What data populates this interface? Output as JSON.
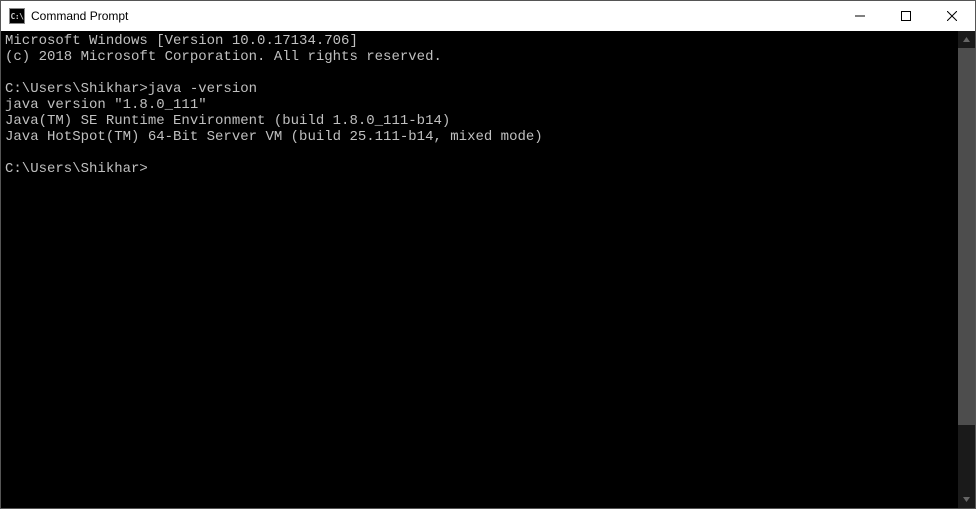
{
  "window": {
    "title": "Command Prompt",
    "icon_label": "C:\\"
  },
  "terminal": {
    "lines": [
      "Microsoft Windows [Version 10.0.17134.706]",
      "(c) 2018 Microsoft Corporation. All rights reserved.",
      "",
      "C:\\Users\\Shikhar>java -version",
      "java version \"1.8.0_111\"",
      "Java(TM) SE Runtime Environment (build 1.8.0_111-b14)",
      "Java HotSpot(TM) 64-Bit Server VM (build 25.111-b14, mixed mode)",
      ""
    ],
    "prompt": "C:\\Users\\Shikhar>"
  }
}
